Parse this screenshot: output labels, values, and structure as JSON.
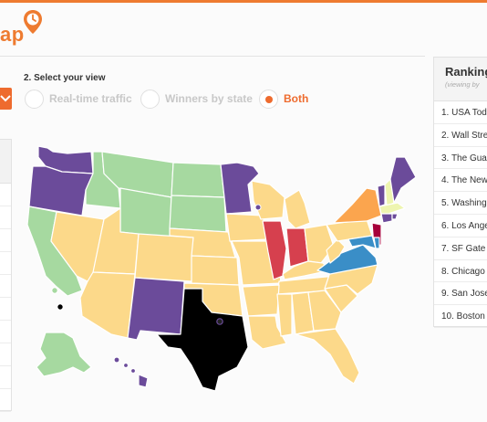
{
  "header": {
    "logo_text": "ap",
    "accent_color": "#ee7b30",
    "logo_icon": "clock-pin-icon"
  },
  "controls": {
    "step_label": "2. Select your view",
    "options": [
      {
        "label": "Real-time traffic",
        "selected": false
      },
      {
        "label": "Winners by state",
        "selected": false
      },
      {
        "label": "Both",
        "selected": true
      }
    ],
    "collapse_icon": "chevron-down-icon"
  },
  "ranking": {
    "title": "Ranking",
    "subtitle": "(viewing by",
    "items": [
      "1. USA Tod",
      "2. Wall Stre",
      "3. The Gua",
      "4. The New",
      "5. Washing",
      "6. Los Ange",
      "7. SF Gate",
      "8. Chicago",
      "9. San Jose",
      "10. Boston"
    ]
  },
  "map": {
    "colors": {
      "purple": "#6b4b9a",
      "green": "#a6d9a0",
      "yellow": "#fcd98a",
      "orange": "#fba54e",
      "red": "#d6404e",
      "crimson": "#a6003b",
      "blue": "#3a8ec7",
      "black": "#000000",
      "lightyellow": "#eef5b0"
    },
    "legend_note": ""
  }
}
